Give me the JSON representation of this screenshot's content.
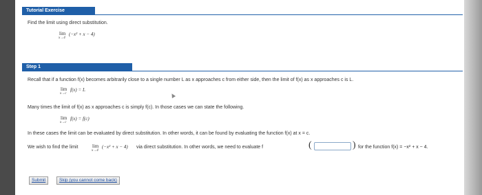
{
  "tutorial": {
    "header": "Tutorial Exercise",
    "instruction": "Find the limit using direct substitution.",
    "limit_word": "lim",
    "limit_sub": "x→4",
    "limit_expr": "(−x² + x − 4)"
  },
  "step": {
    "header": "Step 1",
    "recall_text": "Recall that if a function f(x) becomes arbitrarily close to a single number L as x approaches c from either side, then the limit of f(x) as x approaches c is L.",
    "def1_word": "lim",
    "def1_sub": "x→c",
    "def1_expr": "f(x) = L",
    "many_times_text": "Many times the limit of f(x) as x approaches c is simply f(c). In those cases we can state the following.",
    "def2_word": "lim",
    "def2_sub": "x→c",
    "def2_expr": "f(x) = f(c)",
    "these_cases_text": "In these cases the limit can be evaluated by direct substitution. In other words, it can be found by evaluating the function f(x) at x = c.",
    "wish_prefix": "We wish to find the limit",
    "wish_word": "lim",
    "wish_sub": "x→4",
    "wish_expr": "(−x² + x − 4)",
    "wish_suffix": "via direct substitution. In other words, we need to evaluate f",
    "answer_value": "",
    "for_function_text": "for the function f(x) = −x² + x − 4."
  },
  "buttons": {
    "submit": "Submit",
    "skip": "Skip (you cannot come back)"
  }
}
